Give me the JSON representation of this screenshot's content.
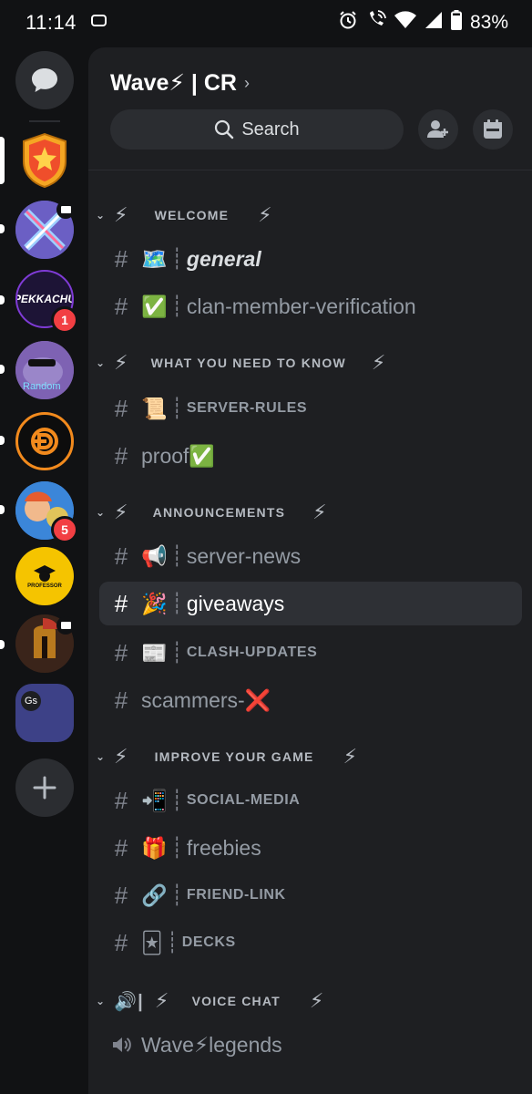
{
  "status_bar": {
    "time": "11:14",
    "battery": "83%",
    "icons": [
      "message-notification-icon",
      "alarm-icon",
      "wifi-call-icon",
      "wifi-icon",
      "signal-icon",
      "battery-icon"
    ]
  },
  "servers": [
    {
      "name": "direct-messages",
      "icon": "chat-bubble-icon"
    },
    {
      "name": "server-wave",
      "selected": true,
      "color": "#f5a623"
    },
    {
      "name": "server-2",
      "unread": true,
      "monitor": true
    },
    {
      "name": "server-pekkachu",
      "label": "PEKKACHU",
      "badge": "1",
      "unread": true
    },
    {
      "name": "server-random",
      "label": "Random",
      "unread": true
    },
    {
      "name": "server-d",
      "unread": true
    },
    {
      "name": "server-5",
      "badge": "5",
      "unread": true
    },
    {
      "name": "server-professor",
      "label": "PROFESSOR"
    },
    {
      "name": "server-spartan",
      "unread": true,
      "monitor": true
    },
    {
      "name": "server-gs",
      "label": "Gs"
    },
    {
      "name": "add-server",
      "icon": "plus-icon"
    }
  ],
  "guild": {
    "name": "Wave⚡ | CR",
    "search_placeholder": "Search",
    "actions": [
      "invite-members-icon",
      "events-calendar-icon"
    ]
  },
  "categories": [
    {
      "label": "WELCOME",
      "bolt": "⚡"
    },
    {
      "label": "WHAT YOU NEED TO KNOW",
      "bolt": "⚡"
    },
    {
      "label": "ANNOUNCEMENTS",
      "bolt": "⚡"
    },
    {
      "label": "IMPROVE YOUR GAME",
      "bolt": "⚡"
    },
    {
      "label": "VOICE CHAT",
      "bolt": "⚡",
      "prefix": "🔊|"
    }
  ],
  "channels": [
    {
      "emoji": "🗺️",
      "sep": "┊",
      "name": "general"
    },
    {
      "emoji": "✅",
      "sep": "┊",
      "name": "clan-member-verification"
    },
    {
      "emoji": "📜",
      "sep": "┊",
      "name": "SERVER-RULES"
    },
    {
      "emoji": "",
      "sep": "",
      "name": "proof✅"
    },
    {
      "emoji": "📢",
      "sep": "┊",
      "name": "server-news"
    },
    {
      "emoji": "🎉",
      "sep": "┊",
      "name": "giveaways",
      "active": true
    },
    {
      "emoji": "📰",
      "sep": "┊",
      "name": "CLASH-UPDATES"
    },
    {
      "emoji": "",
      "sep": "",
      "name": "scammers-❌"
    },
    {
      "emoji": "📲",
      "sep": "┊",
      "name": "SOCIAL-MEDIA"
    },
    {
      "emoji": "🎁",
      "sep": "┊",
      "name": "freebies"
    },
    {
      "emoji": "🔗",
      "sep": "┊",
      "name": "FRIEND-LINK"
    },
    {
      "emoji": "🃏",
      "sep": "┊",
      "name": "DECKS"
    },
    {
      "emoji": "",
      "sep": "",
      "name": "Wave⚡legends",
      "type": "voice"
    }
  ]
}
